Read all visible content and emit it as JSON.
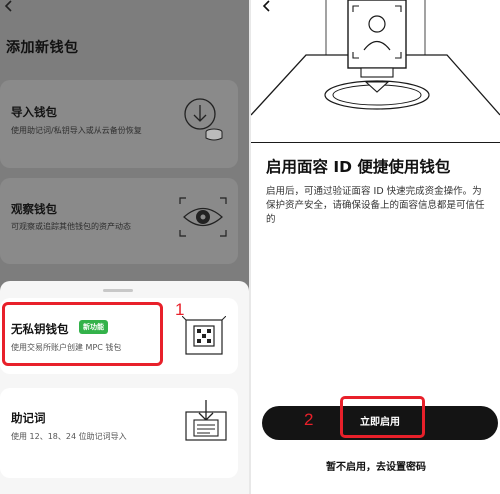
{
  "left": {
    "back_icon": "chevron-left-icon",
    "title": "添加新钱包",
    "cards": {
      "import": {
        "title": "导入钱包",
        "subtitle": "使用助记词/私钥导入或从云备份恢复",
        "icon": "import-icon"
      },
      "watch": {
        "title": "观察钱包",
        "subtitle": "可观察或追踪其他钱包的资产动态",
        "icon": "eye-icon"
      },
      "keyless": {
        "title": "无私钥钱包",
        "badge": "新功能",
        "subtitle": "使用交易所账户创建 MPC 钱包",
        "icon": "keyless-wallet-icon"
      },
      "mnemonic": {
        "title": "助记词",
        "subtitle": "使用 12、18、24 位助记词导入",
        "icon": "mnemonic-icon"
      }
    },
    "annotation_number": "1"
  },
  "right": {
    "back_icon": "chevron-left-icon",
    "title": "启用面容 ID 便捷使用钱包",
    "description": "启用后，可通过验证面容 ID 快速完成资金操作。为保护资产安全，请确保设备上的面容信息都是可信任的",
    "enable_button": "立即启用",
    "skip_link": "暂不启用，去设置密码",
    "annotation_number": "2"
  },
  "colors": {
    "accent_red": "#e8202a",
    "badge_green": "#33b24a",
    "button_black": "#141414"
  }
}
